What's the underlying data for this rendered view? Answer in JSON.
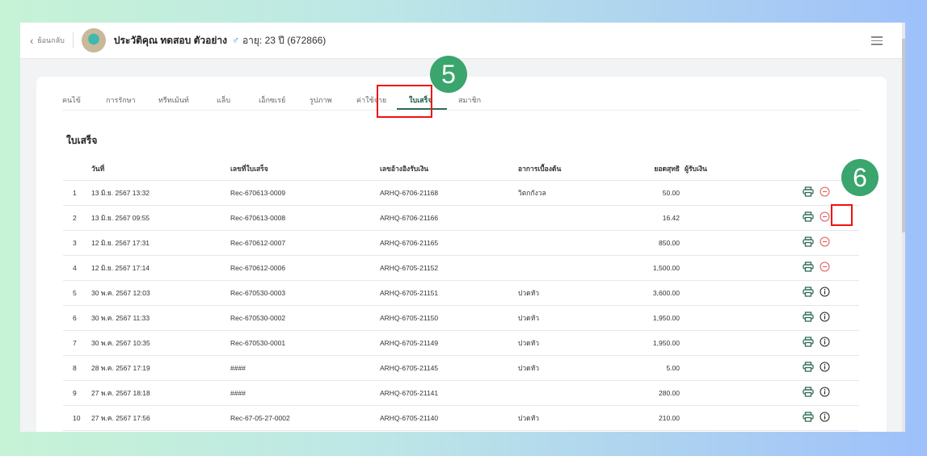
{
  "header": {
    "back_label": "ย้อนกลับ",
    "patient_name": "ประวัติคุณ ทดสอบ ตัวอย่าง",
    "gender_symbol": "♂",
    "age_label": "อายุ: 23 ปี",
    "patient_id": "(672866)"
  },
  "tabs": [
    "คนไข้",
    "การรักษา",
    "ทรีทเม้นท์",
    "แล็บ",
    "เอ็กซเรย์",
    "รูปภาพ",
    "ค่าใช้จ่าย",
    "ใบเสร็จ",
    "สมาชิก"
  ],
  "active_tab": "ใบเสร็จ",
  "section_title": "ใบเสร็จ",
  "annotations": {
    "step5": "5",
    "step6": "6"
  },
  "columns": {
    "date": "วันที่",
    "receipt_no": "เลขที่ใบเสร็จ",
    "ref": "เลขอ้างอิงรับเงิน",
    "symptom": "อาการเบื้องต้น",
    "net": "ยอดสุทธิ",
    "payer": "ผู้รับเงิน"
  },
  "rows": [
    {
      "n": "1",
      "date": "13 มิ.ย. 2567 13:32",
      "receipt": "Rec-670613-0009",
      "ref": "ARHQ-6706-21168",
      "symptom": "วิตกกังวล",
      "net": "50.00",
      "status": "cancel"
    },
    {
      "n": "2",
      "date": "13 มิ.ย. 2567 09:55",
      "receipt": "Rec-670613-0008",
      "ref": "ARHQ-6706-21166",
      "symptom": "",
      "net": "16.42",
      "status": "cancel"
    },
    {
      "n": "3",
      "date": "12 มิ.ย. 2567 17:31",
      "receipt": "Rec-670612-0007",
      "ref": "ARHQ-6706-21165",
      "symptom": "",
      "net": "850.00",
      "status": "cancel"
    },
    {
      "n": "4",
      "date": "12 มิ.ย. 2567 17:14",
      "receipt": "Rec-670612-0006",
      "ref": "ARHQ-6705-21152",
      "symptom": "",
      "net": "1,500.00",
      "status": "cancel"
    },
    {
      "n": "5",
      "date": "30 พ.ค. 2567 12:03",
      "receipt": "Rec-670530-0003",
      "ref": "ARHQ-6705-21151",
      "symptom": "ปวดหัว",
      "net": "3,600.00",
      "status": "info"
    },
    {
      "n": "6",
      "date": "30 พ.ค. 2567 11:33",
      "receipt": "Rec-670530-0002",
      "ref": "ARHQ-6705-21150",
      "symptom": "ปวดหัว",
      "net": "1,950.00",
      "status": "info"
    },
    {
      "n": "7",
      "date": "30 พ.ค. 2567 10:35",
      "receipt": "Rec-670530-0001",
      "ref": "ARHQ-6705-21149",
      "symptom": "ปวดหัว",
      "net": "1,950.00",
      "status": "info"
    },
    {
      "n": "8",
      "date": "28 พ.ค. 2567 17:19",
      "receipt": "####",
      "ref": "ARHQ-6705-21145",
      "symptom": "ปวดหัว",
      "net": "5.00",
      "status": "info"
    },
    {
      "n": "9",
      "date": "27 พ.ค. 2567 18:18",
      "receipt": "####",
      "ref": "ARHQ-6705-21141",
      "symptom": "",
      "net": "280.00",
      "status": "info"
    },
    {
      "n": "10",
      "date": "27 พ.ค. 2567 17:56",
      "receipt": "Rec-67-05-27-0002",
      "ref": "ARHQ-6705-21140",
      "symptom": "ปวดหัว",
      "net": "210.00",
      "status": "info"
    }
  ],
  "colors": {
    "accent": "#2e6b58",
    "cancel": "#e05555",
    "badge": "#3aa56d",
    "highlight": "#e11111"
  }
}
